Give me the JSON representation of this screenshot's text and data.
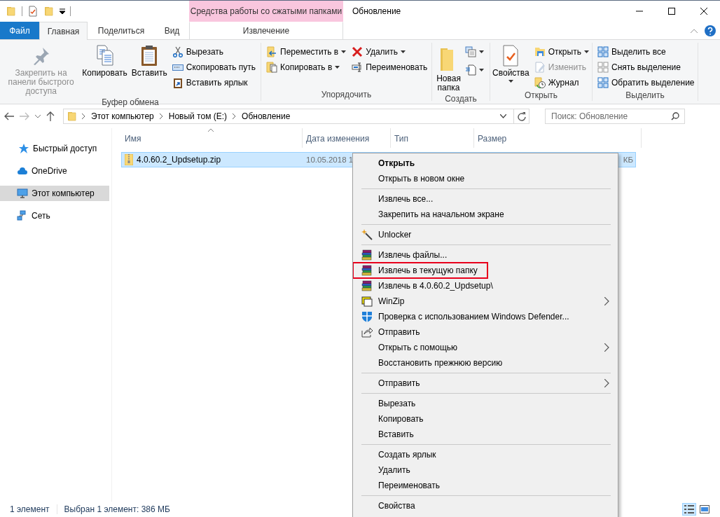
{
  "window": {
    "title": "Обновление",
    "contextual_header": "Средства работы со сжатыми папками"
  },
  "tabs": [
    {
      "label": "Файл",
      "kind": "file",
      "selected": false
    },
    {
      "label": "Главная",
      "kind": "normal",
      "selected": true
    },
    {
      "label": "Поделиться",
      "kind": "normal",
      "selected": false
    },
    {
      "label": "Вид",
      "kind": "normal",
      "selected": false
    },
    {
      "label": "Извлечение",
      "kind": "contextual",
      "selected": false
    }
  ],
  "ribbon": {
    "groups": [
      {
        "label": "Буфер обмена",
        "columns": [
          {
            "kind": "large",
            "label": "Закрепить на панели быстрого доступа",
            "disabled": true
          },
          {
            "kind": "large",
            "label": "Копировать"
          },
          {
            "kind": "large",
            "label": "Вставить"
          },
          {
            "kind": "stack",
            "items": [
              {
                "label": "Вырезать"
              },
              {
                "label": "Скопировать путь"
              },
              {
                "label": "Вставить ярлык"
              }
            ]
          }
        ]
      },
      {
        "label": "Упорядочить",
        "columns": [
          {
            "kind": "stack",
            "items": [
              {
                "label": "Переместить в",
                "dropdown": true
              },
              {
                "label": "Копировать в",
                "dropdown": true
              }
            ]
          },
          {
            "kind": "stack",
            "items": [
              {
                "label": "Удалить",
                "dropdown": true
              },
              {
                "label": "Переименовать"
              }
            ]
          }
        ]
      },
      {
        "label": "Создать",
        "columns": [
          {
            "kind": "large",
            "label": "Новая папка"
          },
          {
            "kind": "stack",
            "items": [
              {
                "dropdown": true
              },
              {
                "dropdown": true
              }
            ]
          }
        ]
      },
      {
        "label": "Открыть",
        "columns": [
          {
            "kind": "large",
            "label": "Свойства",
            "dropdown": true
          },
          {
            "kind": "stack",
            "items": [
              {
                "label": "Открыть",
                "dropdown": true
              },
              {
                "label": "Изменить",
                "disabled": true
              },
              {
                "label": "Журнал"
              }
            ]
          }
        ]
      },
      {
        "label": "Выделить",
        "columns": [
          {
            "kind": "stack",
            "items": [
              {
                "label": "Выделить все"
              },
              {
                "label": "Снять выделение"
              },
              {
                "label": "Обратить выделение"
              }
            ]
          }
        ]
      }
    ]
  },
  "address": {
    "path": [
      "Этот компьютер",
      "Новый том (E:)",
      "Обновление"
    ],
    "search_placeholder": "Поиск: Обновление"
  },
  "sidebar": {
    "items": [
      {
        "label": "Быстрый доступ",
        "selected": false
      },
      {
        "label": "OneDrive",
        "selected": false
      },
      {
        "label": "Этот компьютер",
        "selected": true
      },
      {
        "label": "Сеть",
        "selected": false
      }
    ]
  },
  "table": {
    "columns": [
      "Имя",
      "Дата изменения",
      "Тип",
      "Размер"
    ],
    "rows": [
      {
        "name": "4.0.60.2_Updsetup.zip",
        "date": "10.05.2018 1",
        "size": "КБ",
        "selected": true
      }
    ]
  },
  "context_menu": {
    "items": [
      {
        "kind": "item",
        "label": "Открыть",
        "default": true
      },
      {
        "kind": "item",
        "label": "Открыть в новом окне"
      },
      {
        "kind": "separator"
      },
      {
        "kind": "item",
        "label": "Извлечь все..."
      },
      {
        "kind": "item",
        "label": "Закрепить на начальном экране"
      },
      {
        "kind": "separator"
      },
      {
        "kind": "item",
        "label": "Unlocker"
      },
      {
        "kind": "separator"
      },
      {
        "kind": "item",
        "label": "Извлечь файлы..."
      },
      {
        "kind": "item",
        "label": "Извлечь в текущую папку",
        "highlighted": true
      },
      {
        "kind": "item",
        "label": "Извлечь в 4.0.60.2_Updsetup\\"
      },
      {
        "kind": "item",
        "label": "WinZip",
        "submenu": true
      },
      {
        "kind": "item",
        "label": "Проверка с использованием Windows Defender..."
      },
      {
        "kind": "item",
        "label": "Отправить"
      },
      {
        "kind": "item",
        "label": "Открыть с помощью",
        "submenu": true
      },
      {
        "kind": "item",
        "label": "Восстановить прежнюю версию"
      },
      {
        "kind": "separator"
      },
      {
        "kind": "item",
        "label": "Отправить",
        "submenu": true
      },
      {
        "kind": "separator"
      },
      {
        "kind": "item",
        "label": "Вырезать"
      },
      {
        "kind": "item",
        "label": "Копировать"
      },
      {
        "kind": "item",
        "label": "Вставить"
      },
      {
        "kind": "separator"
      },
      {
        "kind": "item",
        "label": "Создать ярлык"
      },
      {
        "kind": "item",
        "label": "Удалить"
      },
      {
        "kind": "item",
        "label": "Переименовать"
      },
      {
        "kind": "separator"
      },
      {
        "kind": "item",
        "label": "Свойства"
      }
    ]
  },
  "status_bar": {
    "count": "1 элемент",
    "selection": "Выбран 1 элемент: 386 МБ",
    "views": [
      {
        "selected": true
      },
      {
        "selected": false
      }
    ]
  }
}
